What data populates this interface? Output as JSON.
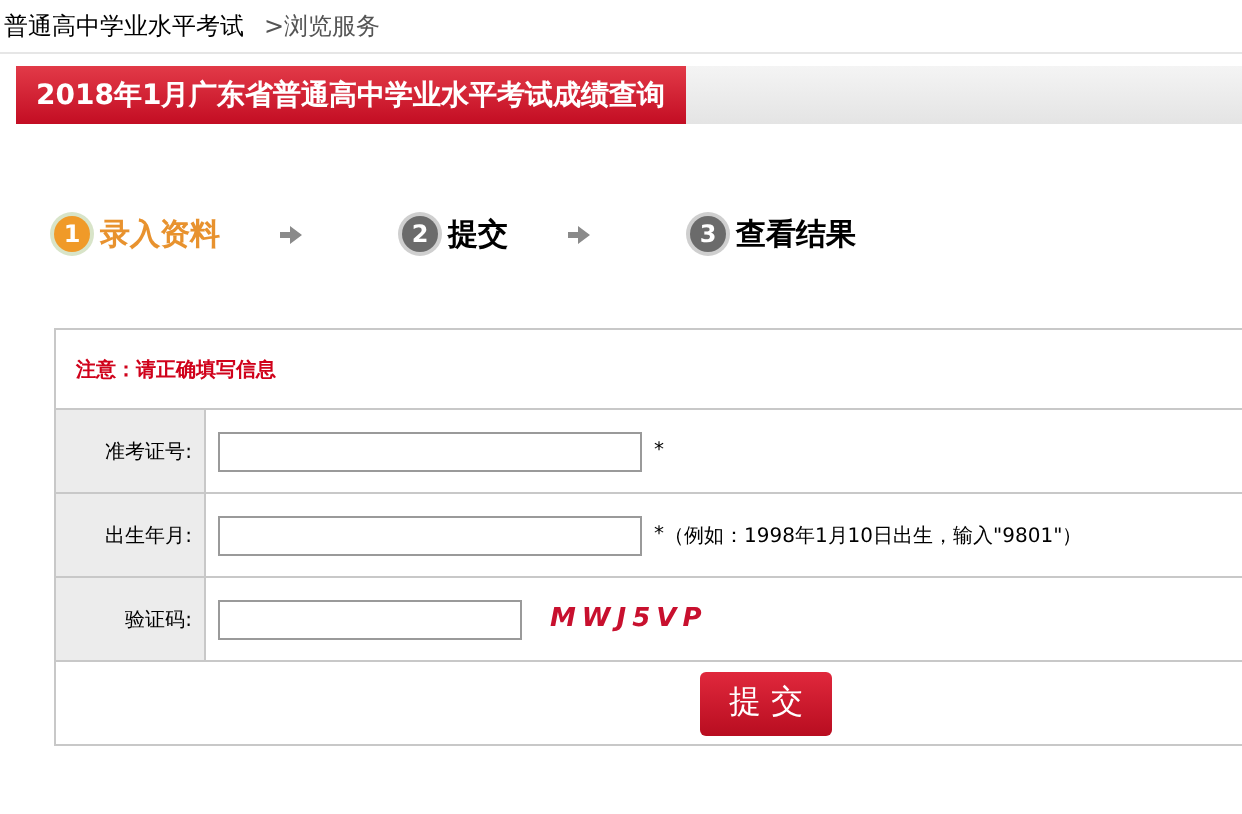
{
  "breadcrumb": {
    "site": "普通高中学业水平考试",
    "section": ">浏览服务"
  },
  "title": "2018年1月广东省普通高中学业水平考试成绩查询",
  "steps": [
    {
      "number": "1",
      "label": "录入资料",
      "selected": true
    },
    {
      "number": "2",
      "label": "提交",
      "selected": false
    },
    {
      "number": "3",
      "label": "查看结果",
      "selected": false
    }
  ],
  "form": {
    "notice": "注意：请正确填写信息",
    "fields": [
      {
        "kind": "text",
        "label": "准考证号:",
        "required": "*"
      },
      {
        "kind": "text",
        "label": "出生年月:",
        "required": "*",
        "hint": "（例如：1998年1月10日出生，输入\"9801\"）"
      },
      {
        "kind": "captcha",
        "label": "验证码:",
        "code": "MWJ5VP"
      }
    ],
    "submit": "提 交"
  }
}
